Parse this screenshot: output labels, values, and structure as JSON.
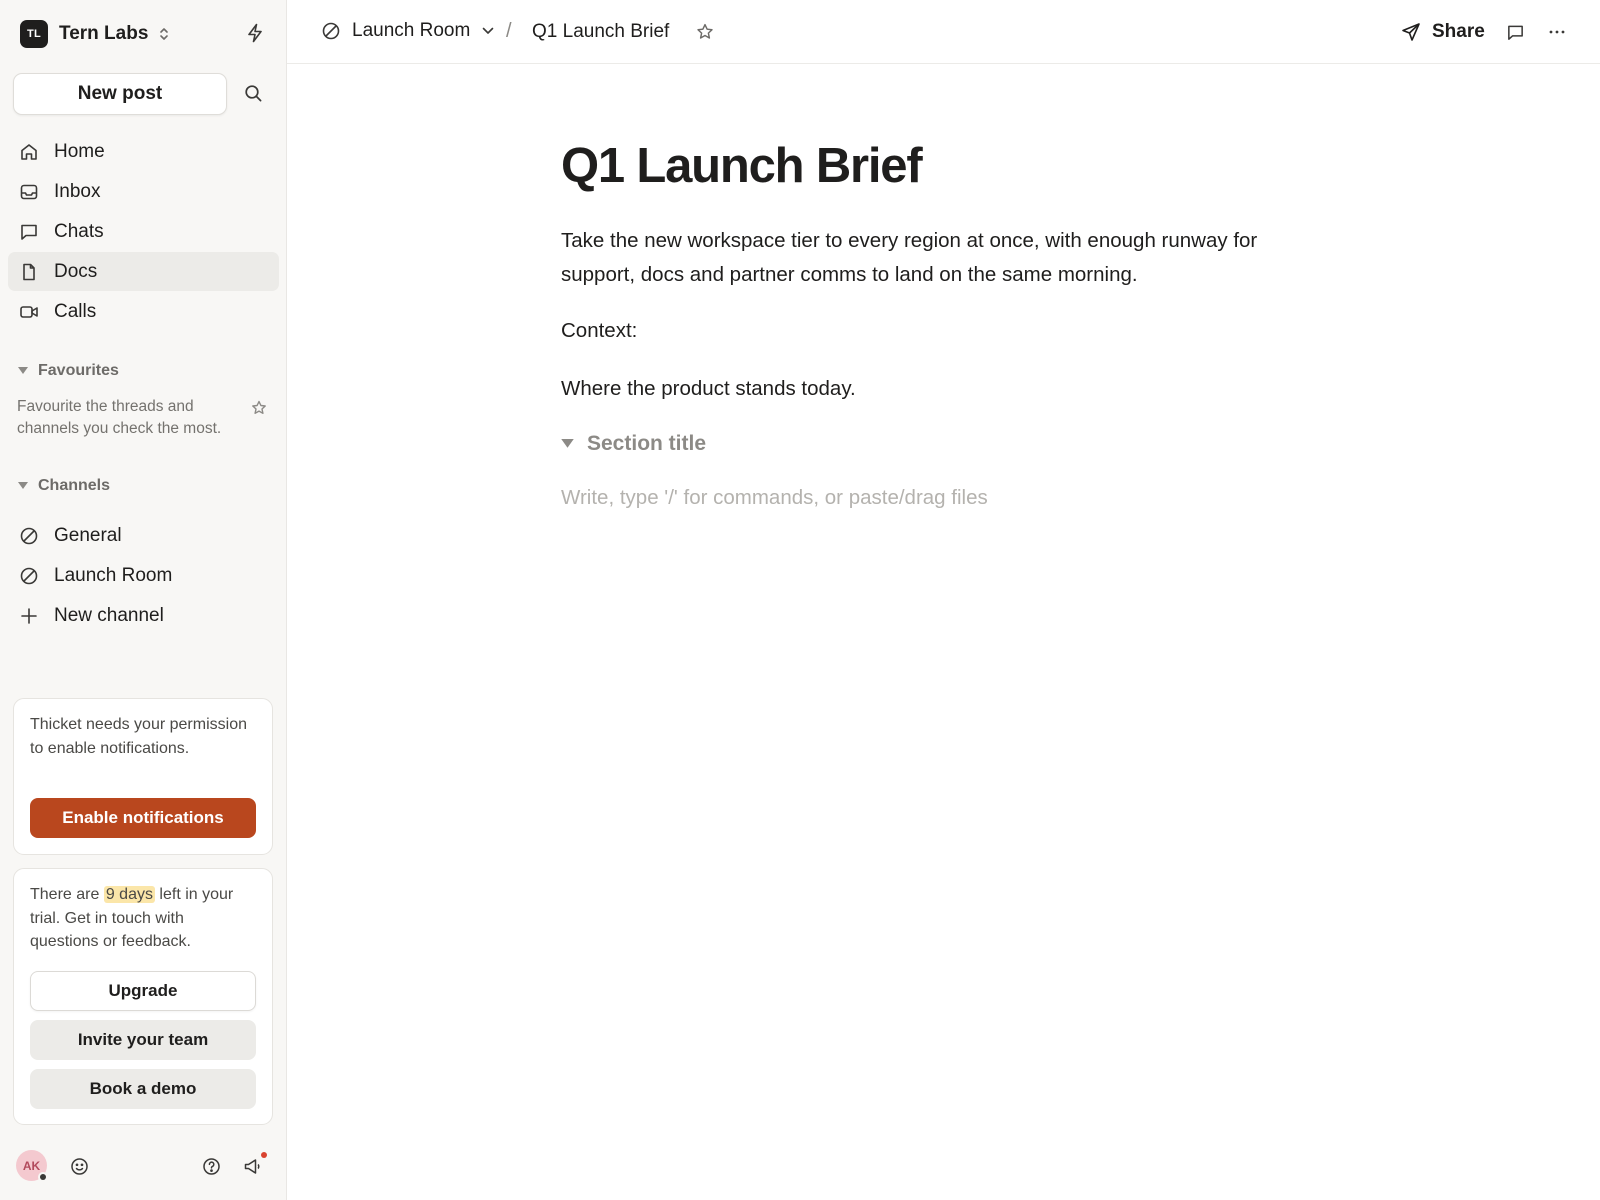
{
  "workspace": {
    "initials": "TL",
    "name": "Tern Labs"
  },
  "sidebar": {
    "new_post_label": "New post",
    "nav": [
      {
        "label": "Home",
        "icon": "home-icon"
      },
      {
        "label": "Inbox",
        "icon": "inbox-icon"
      },
      {
        "label": "Chats",
        "icon": "chat-icon"
      },
      {
        "label": "Docs",
        "icon": "doc-icon",
        "active": true
      },
      {
        "label": "Calls",
        "icon": "video-icon"
      }
    ],
    "favourites": {
      "heading": "Favourites",
      "hint": "Favourite the threads and channels you check the most."
    },
    "channels": {
      "heading": "Channels",
      "items": [
        {
          "label": "General",
          "icon": "channel-icon"
        },
        {
          "label": "Launch Room",
          "icon": "channel-icon"
        },
        {
          "label": "New channel",
          "icon": "plus-icon"
        }
      ]
    },
    "notify_card": {
      "text": "Thicket needs your permission to enable notifications.",
      "button": "Enable notifications"
    },
    "trial_card": {
      "text_before": "There are",
      "highlight": "9 days",
      "text_after": "left in your trial. Get in touch with questions or feedback.",
      "upgrade": "Upgrade",
      "invite": "Invite your team",
      "demo": "Book a demo"
    },
    "footer": {
      "avatar_initials": "AK"
    }
  },
  "topbar": {
    "channel": "Launch Room",
    "separator": "/",
    "doc_title": "Q1 Launch Brief",
    "share_label": "Share"
  },
  "doc": {
    "title": "Q1 Launch Brief",
    "paragraph1": "Take the new workspace tier to every region at once, with enough runway for support, docs and partner comms to land on the same morning.",
    "paragraph2": "Context:",
    "paragraph3": "Where the product stands today.",
    "section_title": "Section title",
    "placeholder": "Write, type '/' for commands, or paste/drag files"
  },
  "colors": {
    "accent": "#b9471e",
    "highlight": "#fbe6a9",
    "sidebar_bg": "#f8f7f5",
    "notification_dot": "#d9432f"
  }
}
